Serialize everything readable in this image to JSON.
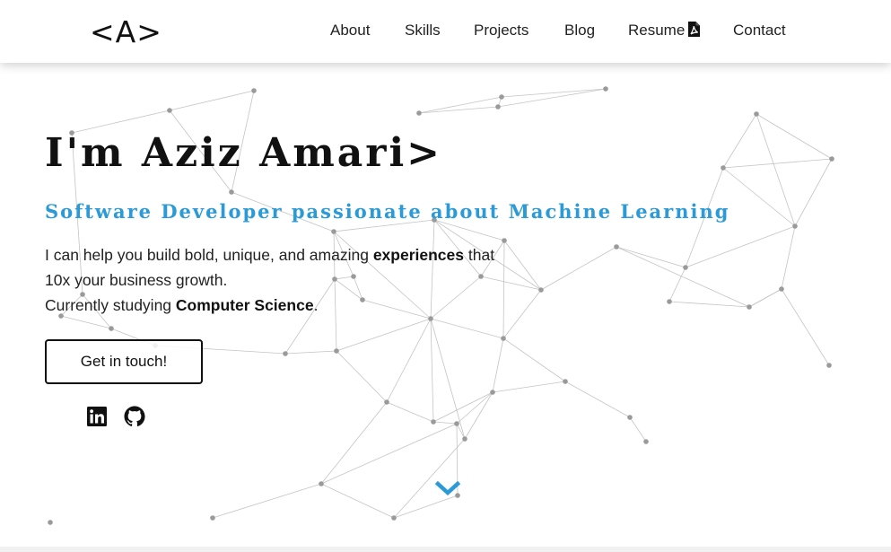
{
  "header": {
    "logo": "<A>",
    "nav": [
      {
        "label": "About"
      },
      {
        "label": "Skills"
      },
      {
        "label": "Projects"
      },
      {
        "label": "Blog"
      },
      {
        "label": "Resume",
        "icon": "pdf-file-icon"
      },
      {
        "label": "Contact"
      }
    ]
  },
  "hero": {
    "title": "I'm Aziz Amari>",
    "subtitle": "Software Developer passionate about Machine Learning",
    "intro": {
      "line1_pre": "I can help you build bold, unique, and amazing ",
      "line1_bold": "experiences",
      "line1_post": " that",
      "line2": "10x your business growth.",
      "line3_pre": "Currently studying ",
      "line3_bold": "Computer Science",
      "line3_post": "."
    },
    "cta_label": "Get in touch!",
    "social": [
      {
        "icon": "linkedin-icon"
      },
      {
        "icon": "github-icon"
      }
    ],
    "scroll_icon": "chevron-down-icon"
  },
  "colors": {
    "accent": "#2b9ad6",
    "text": "#111111",
    "background": "#ffffff",
    "network": "#c4c4c4"
  }
}
